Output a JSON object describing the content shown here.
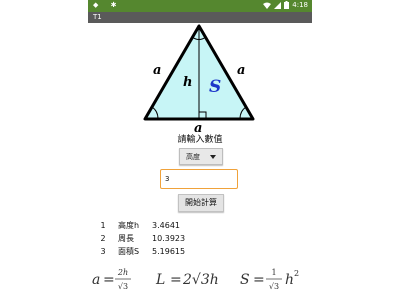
{
  "status_bar": {
    "time": "4:18"
  },
  "app_bar": {
    "title": "T1"
  },
  "figure": {
    "side_label": "a",
    "height_label": "h",
    "area_label": "S",
    "base_label": "a"
  },
  "prompt": "請輸入數值",
  "type_select": {
    "selected": "高度"
  },
  "value_input": {
    "value": "3"
  },
  "calc_button": {
    "label": "開始計算"
  },
  "results": [
    {
      "index": "1",
      "label": "高度h",
      "value": "3.4641"
    },
    {
      "index": "2",
      "label": "周長",
      "value": "10.3923"
    },
    {
      "index": "3",
      "label": "面積S",
      "value": "5.19615"
    }
  ],
  "formulas": {
    "f1": {
      "lhs": "a",
      "eq": "=",
      "num": "2h",
      "den": "√3"
    },
    "f2": {
      "lhs": "L",
      "eq": "=",
      "rhs": "2√3h"
    },
    "f3": {
      "lhs": "S",
      "eq": "=",
      "num": "1",
      "den": "√3",
      "tail": "h",
      "sup": "2"
    }
  },
  "colors": {
    "status_bar": "#55872f",
    "app_bar": "#5a5a5a",
    "triangle_fill": "#c7f5f6",
    "area_label": "#1c35c9",
    "input_border": "#f0a23a"
  }
}
